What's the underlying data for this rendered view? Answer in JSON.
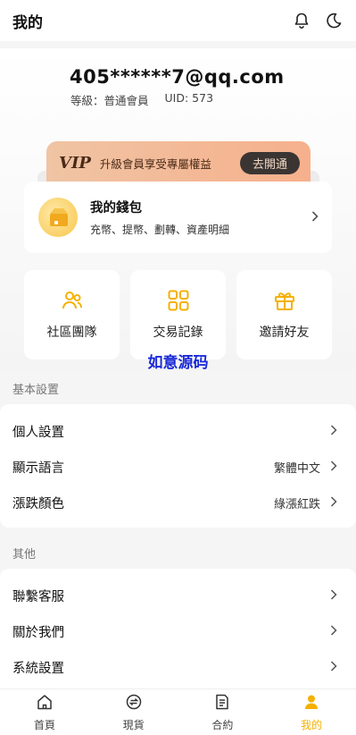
{
  "header": {
    "title": "我的",
    "icons": [
      "bell-icon",
      "moon-icon"
    ]
  },
  "profile": {
    "email": "405******7@qq.com",
    "level": "等級：普通會員",
    "uid": "UID: 573"
  },
  "vip_banner": {
    "logo": "VIP",
    "text": "升級會員享受專屬權益",
    "button": "去開通"
  },
  "wallet": {
    "title": "我的錢包",
    "subtitle": "充幣、提幣、劃轉、資產明細"
  },
  "quick_actions": [
    {
      "label": "社區團隊",
      "icon": "team-icon"
    },
    {
      "label": "交易記錄",
      "icon": "grid-icon"
    },
    {
      "label": "邀請好友",
      "icon": "gift-icon"
    }
  ],
  "watermark": "如意源码",
  "basic_settings": {
    "title": "基本設置",
    "rows": [
      {
        "label": "個人設置",
        "value": ""
      },
      {
        "label": "顯示語言",
        "value": "繁體中文"
      },
      {
        "label": "漲跌顏色",
        "value": "綠漲紅跌"
      }
    ]
  },
  "other": {
    "title": "其他",
    "rows": [
      {
        "label": "聯繫客服",
        "value": ""
      },
      {
        "label": "關於我們",
        "value": ""
      },
      {
        "label": "系統設置",
        "value": ""
      }
    ]
  },
  "tabbar": [
    {
      "label": "首頁",
      "icon": "home-icon",
      "active": false
    },
    {
      "label": "現貨",
      "icon": "exchange-icon",
      "active": false
    },
    {
      "label": "合約",
      "icon": "contract-icon",
      "active": false
    },
    {
      "label": "我的",
      "icon": "user-icon",
      "active": true
    }
  ],
  "colors": {
    "accent": "#F5B100",
    "vip_bg": "#F3B896",
    "watermark": "#1A2AD8"
  }
}
